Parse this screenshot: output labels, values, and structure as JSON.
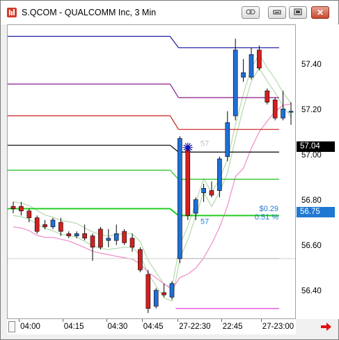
{
  "window": {
    "title": "S.QCOM - QUALCOMM Inc, 3 Min",
    "icon": "bars-icon",
    "buttons": {
      "link": "chain-link-icon",
      "minimize": "minimize-icon",
      "restore": "restore-icon",
      "close": "close-icon"
    }
  },
  "colors": {
    "up_bar": "#1f6fd8",
    "down_bar": "#d42020",
    "price_badge": "#000000",
    "cursor_badge": "#1f78d1",
    "navy_line": "#1a1aa0",
    "purple_line": "#8a1a8a",
    "red_line": "#cc1a1a",
    "green_line": "#1fbf1f",
    "magenta_line": "#e040e0",
    "pink_band": "#f08ac8",
    "sage_band": "#b8dcb0"
  },
  "price_axis": {
    "labels": [
      "57.40",
      "57.20",
      "57.00",
      "56.80",
      "56.60",
      "56.40"
    ],
    "current_price": "57.04",
    "cursor_price": "56.75"
  },
  "time_axis": {
    "labels": [
      "04:00",
      "04:15",
      "04:30",
      "04:45",
      "27-22:30",
      "22:45",
      "27-23:00"
    ]
  },
  "annotations": {
    "change_value": "$0.29",
    "change_percent": "0.51 %",
    "level_label_upper": "57",
    "level_label_lower": "57"
  },
  "chart_data": {
    "type": "candlestick",
    "title": "S.QCOM - QUALCOMM Inc, 3 Min",
    "ylim": [
      56.28,
      57.58
    ],
    "yticks": [
      56.4,
      56.6,
      56.8,
      57.0,
      57.2,
      57.4
    ],
    "xticks": [
      "04:00",
      "04:15",
      "04:30",
      "04:45",
      "27-22:30",
      "22:45",
      "27-23:00"
    ],
    "candles": [
      {
        "o": 56.78,
        "h": 56.8,
        "l": 56.75,
        "c": 56.77
      },
      {
        "o": 56.78,
        "h": 56.8,
        "l": 56.74,
        "c": 56.76
      },
      {
        "o": 56.76,
        "h": 56.77,
        "l": 56.71,
        "c": 56.73
      },
      {
        "o": 56.73,
        "h": 56.74,
        "l": 56.66,
        "c": 56.67
      },
      {
        "o": 56.7,
        "h": 56.72,
        "l": 56.68,
        "c": 56.69
      },
      {
        "o": 56.69,
        "h": 56.73,
        "l": 56.68,
        "c": 56.72
      },
      {
        "o": 56.71,
        "h": 56.73,
        "l": 56.65,
        "c": 56.67
      },
      {
        "o": 56.66,
        "h": 56.67,
        "l": 56.64,
        "c": 56.65
      },
      {
        "o": 56.65,
        "h": 56.67,
        "l": 56.64,
        "c": 56.66
      },
      {
        "o": 56.66,
        "h": 56.7,
        "l": 56.63,
        "c": 56.64
      },
      {
        "o": 56.65,
        "h": 56.66,
        "l": 56.54,
        "c": 56.6
      },
      {
        "o": 56.68,
        "h": 56.69,
        "l": 56.59,
        "c": 56.6
      },
      {
        "o": 56.63,
        "h": 56.68,
        "l": 56.6,
        "c": 56.64
      },
      {
        "o": 56.63,
        "h": 56.7,
        "l": 56.61,
        "c": 56.66
      },
      {
        "o": 56.67,
        "h": 56.68,
        "l": 56.61,
        "c": 56.62
      },
      {
        "o": 56.64,
        "h": 56.66,
        "l": 56.58,
        "c": 56.6
      },
      {
        "o": 56.59,
        "h": 56.6,
        "l": 56.49,
        "c": 56.5
      },
      {
        "o": 56.48,
        "h": 56.5,
        "l": 56.31,
        "c": 56.33
      },
      {
        "o": 56.34,
        "h": 56.42,
        "l": 56.33,
        "c": 56.41
      },
      {
        "o": 56.4,
        "h": 56.44,
        "l": 56.38,
        "c": 56.39
      },
      {
        "o": 56.38,
        "h": 56.45,
        "l": 56.37,
        "c": 56.44
      },
      {
        "o": 56.55,
        "h": 57.09,
        "l": 56.53,
        "c": 57.08
      },
      {
        "o": 57.03,
        "h": 57.04,
        "l": 56.72,
        "c": 56.74
      },
      {
        "o": 56.75,
        "h": 56.82,
        "l": 56.72,
        "c": 56.81
      },
      {
        "o": 56.84,
        "h": 56.88,
        "l": 56.8,
        "c": 56.86
      },
      {
        "o": 56.85,
        "h": 56.89,
        "l": 56.82,
        "c": 56.83
      },
      {
        "o": 56.85,
        "h": 57.0,
        "l": 56.82,
        "c": 56.99
      },
      {
        "o": 57.0,
        "h": 57.2,
        "l": 56.98,
        "c": 57.15
      },
      {
        "o": 57.18,
        "h": 57.52,
        "l": 57.16,
        "c": 57.47
      },
      {
        "o": 57.35,
        "h": 57.43,
        "l": 57.33,
        "c": 57.37
      },
      {
        "o": 57.35,
        "h": 57.48,
        "l": 57.34,
        "c": 57.45
      },
      {
        "o": 57.47,
        "h": 57.49,
        "l": 57.38,
        "c": 57.39
      },
      {
        "o": 57.29,
        "h": 57.3,
        "l": 57.23,
        "c": 57.24
      },
      {
        "o": 57.25,
        "h": 57.26,
        "l": 57.16,
        "c": 57.17
      },
      {
        "o": 57.17,
        "h": 57.29,
        "l": 57.16,
        "c": 57.21
      },
      {
        "o": 57.2,
        "h": 57.24,
        "l": 57.14,
        "c": 57.2
      }
    ],
    "levels": [
      {
        "name": "navy",
        "before": 57.53,
        "after": 57.48
      },
      {
        "name": "purple",
        "before": 57.32,
        "after": 57.26
      },
      {
        "name": "red",
        "before": 57.18,
        "after": 57.12
      },
      {
        "name": "black",
        "before": 57.05,
        "after": 57.02
      },
      {
        "name": "green",
        "before": 56.94,
        "after": 56.9
      },
      {
        "name": "bright-green",
        "before": 56.77,
        "after": 56.74
      },
      {
        "name": "gray",
        "before": null,
        "after": 56.55
      },
      {
        "name": "magenta",
        "before": null,
        "after": 56.33
      }
    ]
  }
}
